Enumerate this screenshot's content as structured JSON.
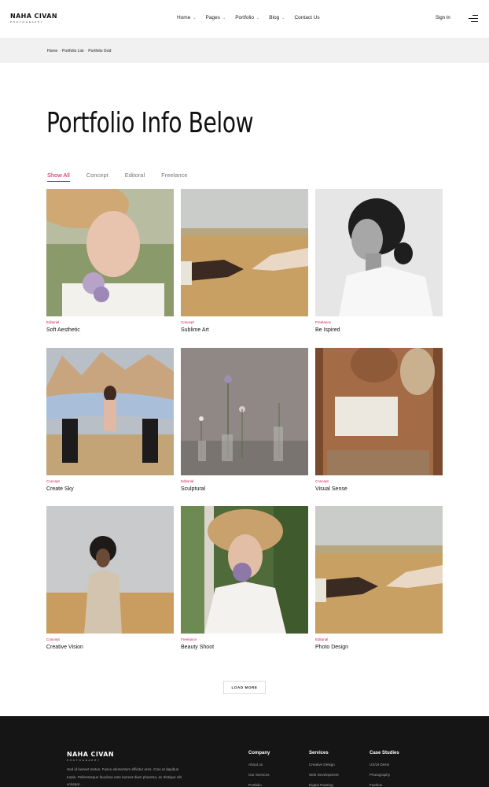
{
  "header": {
    "logo_main": "NAHA CIVAN",
    "logo_sub": "PHOTOGRAPHY",
    "nav": [
      {
        "label": "Home",
        "dropdown": true
      },
      {
        "label": "Pages",
        "dropdown": true
      },
      {
        "label": "Portfolio",
        "dropdown": true
      },
      {
        "label": "Blog",
        "dropdown": true
      },
      {
        "label": "Contact Us",
        "dropdown": false
      }
    ],
    "sign_in": "Sign In",
    "menu_icon": "hamburger-menu-icon"
  },
  "breadcrumb": [
    "Home",
    "Portfolio List",
    "Portfolio Grid"
  ],
  "breadcrumb_separator": "-",
  "page_title": "Portfolio Info Below",
  "filters": [
    "Show All",
    "Concept",
    "Editoral",
    "Freelance"
  ],
  "active_filter": "Show All",
  "portfolio": [
    {
      "category": "Editorial",
      "title": "Soft Aesthetic"
    },
    {
      "category": "Concept",
      "title": "Sublime Art"
    },
    {
      "category": "Freelance",
      "title": "Be Ispired"
    },
    {
      "category": "Concept",
      "title": "Create Sky"
    },
    {
      "category": "Editorial",
      "title": "Sculptural"
    },
    {
      "category": "Concept",
      "title": "Visual Sense"
    },
    {
      "category": "Concept",
      "title": "Creative Vision"
    },
    {
      "category": "Freelance",
      "title": "Beauty Shoot"
    },
    {
      "category": "Editorial",
      "title": "Photo Design"
    }
  ],
  "load_more": "LOAD MORE",
  "footer": {
    "logo_main": "NAHA CIVAN",
    "logo_sub": "PHOTOGRAPHY",
    "description": "Sed id laoreet metus. Fusce elementum efficitur eros. Cras at dapibus turpis. Pellentesque faucibus ante laoreet diam pharetra, ac tristique elit volutpat...",
    "columns": [
      {
        "heading": "Company",
        "links": [
          "About us",
          "Our Services",
          "Portfolio"
        ]
      },
      {
        "heading": "Services",
        "links": [
          "Creative Design",
          "Web Development",
          "Digital Painting"
        ]
      },
      {
        "heading": "Case Studies",
        "links": [
          "UX/UI Desin",
          "Photography",
          "Fashion"
        ]
      }
    ]
  },
  "colors": {
    "accent": "#d0145a",
    "footer_bg": "#151515",
    "breadcrumb_bg": "#f1f1f1"
  }
}
